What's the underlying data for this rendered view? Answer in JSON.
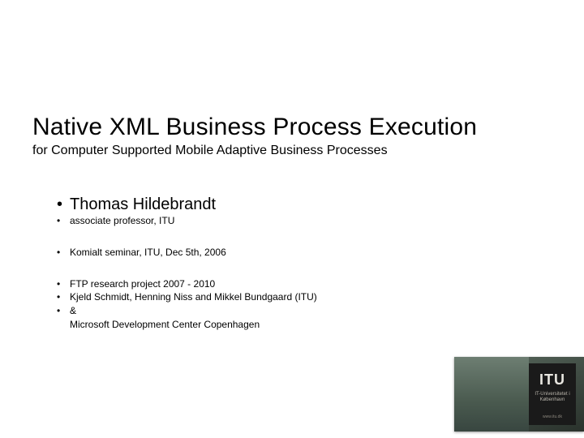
{
  "title": "Native XML Business Process Execution",
  "subtitle": "for Computer Supported Mobile Adaptive Business Processes",
  "author": {
    "name": "Thomas Hildebrandt",
    "role": "associate professor, ITU"
  },
  "event": "Komialt seminar, ITU, Dec 5th, 2006",
  "details": {
    "project": "FTP research project 2007 - 2010",
    "people": " Kjeld Schmidt,  Henning Niss and Mikkel Bundgaard (ITU)",
    "amp": "&",
    "org": "Microsoft Development Center Copenhagen"
  },
  "logo": {
    "label": "ITU",
    "sub1": "IT-Universitetet i København",
    "sub2": "www.itu.dk"
  }
}
